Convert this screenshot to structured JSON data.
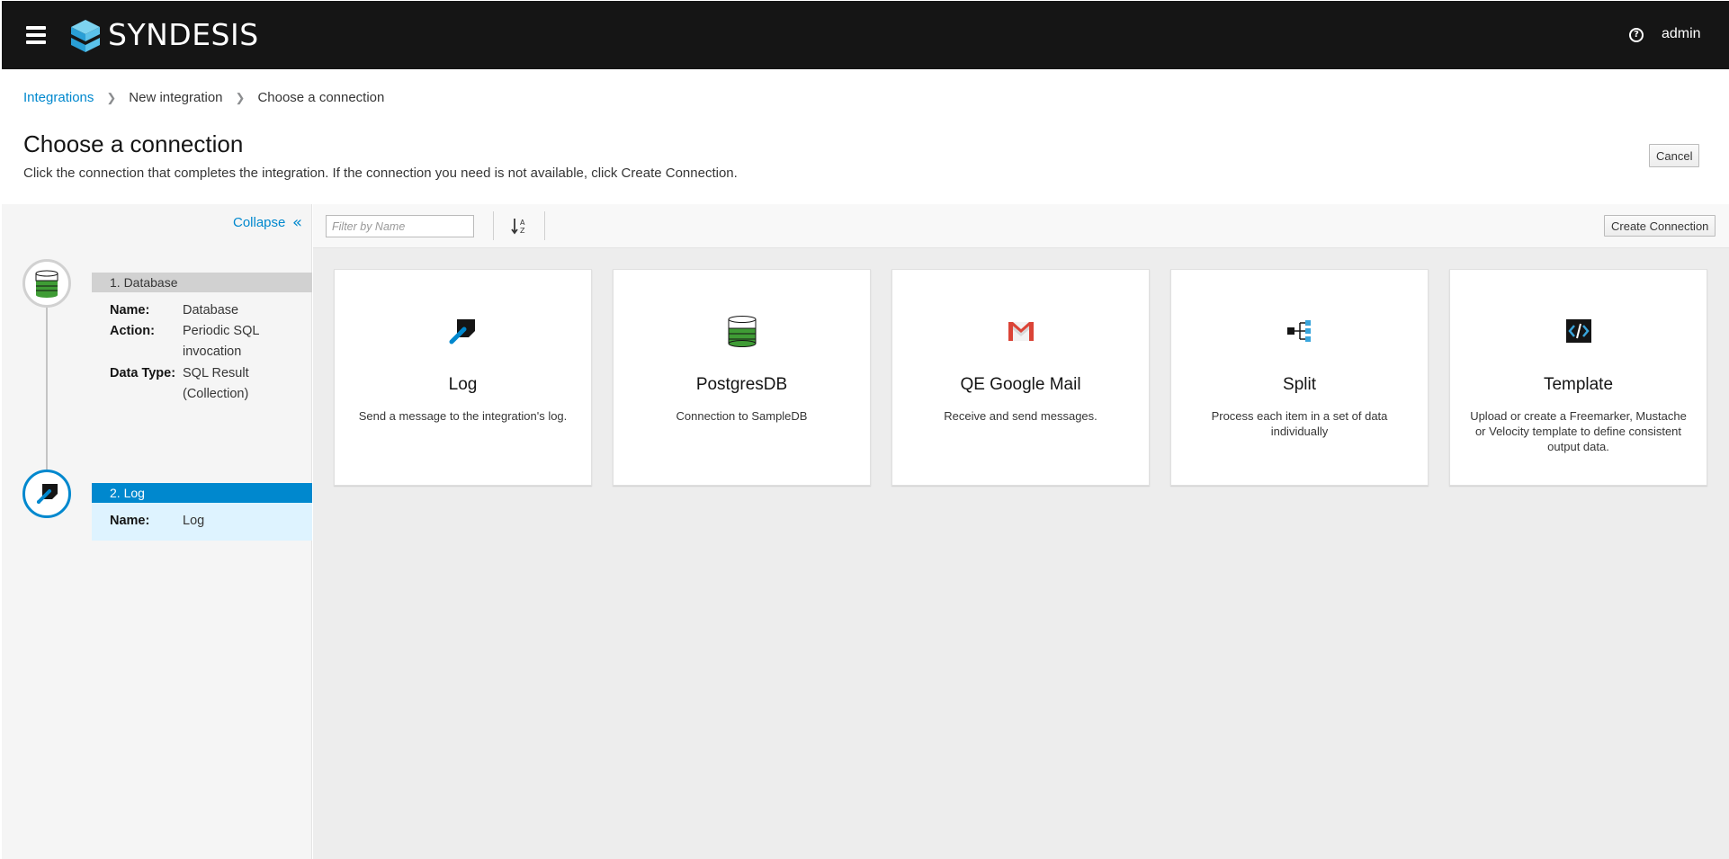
{
  "app": {
    "brand": "SYNDESIS",
    "user": "admin"
  },
  "breadcrumb": {
    "items": [
      "Integrations",
      "New integration",
      "Choose a connection"
    ]
  },
  "header": {
    "title": "Choose a connection",
    "description": "Click the connection that completes the integration. If the connection you need is not available, click Create Connection.",
    "cancel_label": "Cancel"
  },
  "sidebar": {
    "collapse_label": "Collapse",
    "steps": [
      {
        "header": "1. Database",
        "details": [
          {
            "label": "Name:",
            "value_lines": [
              "Database"
            ]
          },
          {
            "label": "Action:",
            "value_lines": [
              "Periodic SQL",
              "invocation"
            ]
          },
          {
            "label": "Data Type:",
            "value_lines": [
              "SQL Result",
              "(Collection)"
            ]
          }
        ]
      },
      {
        "header": "2. Log",
        "details": [
          {
            "label": "Name:",
            "value_lines": [
              "Log"
            ]
          }
        ]
      }
    ]
  },
  "toolbar": {
    "filter_placeholder": "Filter by Name",
    "create_label": "Create Connection"
  },
  "cards": [
    {
      "title": "Log",
      "desc": "Send a message to the integration's log.",
      "icon": "log-icon"
    },
    {
      "title": "PostgresDB",
      "desc": "Connection to SampleDB",
      "icon": "database-icon"
    },
    {
      "title": "QE Google Mail",
      "desc": "Receive and send messages.",
      "icon": "gmail-icon"
    },
    {
      "title": "Split",
      "desc": "Process each item in a set of data individually",
      "icon": "split-icon"
    },
    {
      "title": "Template",
      "desc": "Upload or create a Freemarker, Mustache or Velocity template to define consistent output data.",
      "icon": "template-icon"
    }
  ],
  "colors": {
    "topbar": "#151515",
    "link": "#0088ce",
    "active_step": "#0088ce",
    "active_step_body": "#def3ff",
    "inactive_step": "#d1d1d1",
    "db_green": "#3f9c35"
  }
}
